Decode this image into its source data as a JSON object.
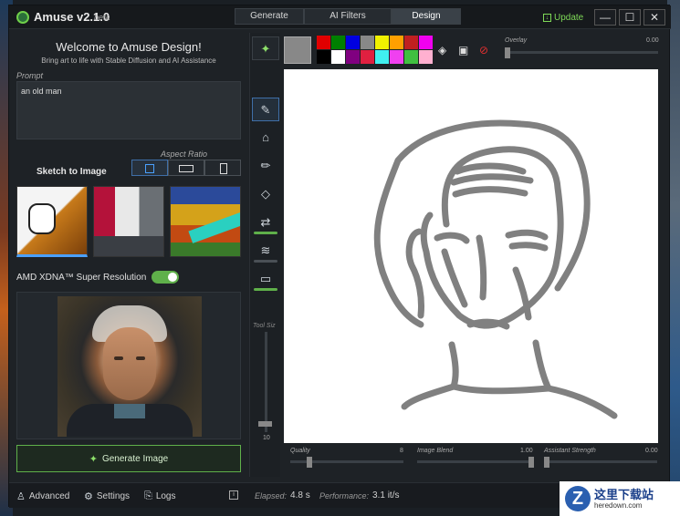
{
  "app": {
    "title": "Amuse v2.1.0",
    "beta": "beta",
    "tabs": [
      {
        "label": "Generate",
        "active": false
      },
      {
        "label": "AI Filters",
        "active": false
      },
      {
        "label": "Design",
        "active": true
      }
    ],
    "update_label": "Update",
    "window_controls": {
      "minimize": "—",
      "maximize": "☐",
      "close": "✕"
    }
  },
  "left_panel": {
    "welcome_title": "Welcome to Amuse Design!",
    "welcome_subtitle": "Bring art to life with Stable Diffusion and AI Assistance",
    "prompt_label": "Prompt",
    "prompt_value": "an old man",
    "aspect_ratio_label": "Aspect Ratio",
    "sketch_label": "Sketch to Image",
    "aspect_options": [
      "square",
      "landscape",
      "portrait"
    ],
    "aspect_selected": "square",
    "thumbnails": [
      "sketch-teddy-bear",
      "sketch-room",
      "sketch-landscape"
    ],
    "super_resolution_label": "AMD XDNA™ Super Resolution",
    "super_resolution_on": true,
    "generate_label": "Generate Image"
  },
  "tool_column": {
    "tools": [
      "magic-wand-icon",
      "brush-icon",
      "stamp-icon",
      "pencil-icon",
      "eraser-icon",
      "shuffle-icon",
      "smudge-icon",
      "sketch-icon"
    ],
    "tool_size_label": "Tool Siz",
    "tool_size_value": "10"
  },
  "canvas_tools": {
    "current_color": "#888888",
    "palette": [
      "#e00000",
      "#008000",
      "#0000e0",
      "#888888",
      "#f0f000",
      "#ffa000",
      "#c02020",
      "#f000f0",
      "#000000",
      "#ffffff",
      "#800080",
      "#e02040",
      "#40f0f0",
      "#f040f0",
      "#40c040",
      "#ffb0d0"
    ],
    "icons": [
      "fill-icon",
      "image-icon",
      "clear-icon"
    ],
    "overlay_label": "Overlay",
    "overlay_value": "0.00",
    "overlay_fraction": 0.0
  },
  "bottom_sliders": [
    {
      "label": "Quality",
      "value": "8",
      "fraction": 0.15
    },
    {
      "label": "Image Blend",
      "value": "1.00",
      "fraction": 1.0
    },
    {
      "label": "Assistant Strength",
      "value": "0.00",
      "fraction": 0.0
    }
  ],
  "statusbar": {
    "advanced": "Advanced",
    "settings": "Settings",
    "logs": "Logs",
    "elapsed_label": "Elapsed:",
    "elapsed_value": "4.8 s",
    "performance_label": "Performance:",
    "performance_value": "3.1 it/s"
  },
  "watermark": {
    "letter": "Z",
    "text": "这里下载站",
    "url": "heredown.com"
  },
  "colors": {
    "accent_green": "#5fb04a",
    "selection_blue": "#3f6fa8",
    "sketch_stroke": "#808080"
  }
}
